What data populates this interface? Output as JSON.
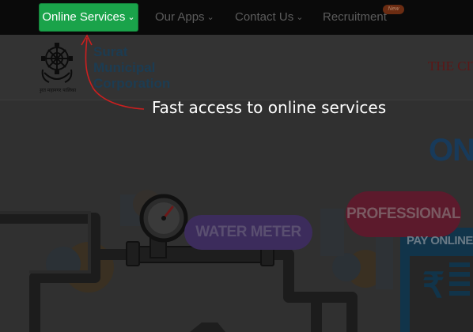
{
  "nav": {
    "online_services": "Online Services",
    "our_apps": "Our Apps",
    "contact_us": "Contact Us",
    "recruitment": "Recruitment",
    "new_badge": "New"
  },
  "header": {
    "logo_line1": "Surat",
    "logo_line2": "Municipal",
    "logo_line3": "Corporation",
    "logo_caption": "सुरत महानगर पालिका",
    "city_text": "THE CITY"
  },
  "hero": {
    "title": "ONL",
    "water_meter": "WATER METER",
    "professional": "PROFESSIONAL",
    "pay_online": "PAY ONLINE T",
    "rupee_symbol": "₹"
  },
  "tour": {
    "tooltip": "Fast access to online services"
  },
  "colors": {
    "active_nav": "#1aa34a",
    "overlay_bg": "#303030",
    "pointer": "#cc1f1f"
  },
  "icons": {
    "nav_chevron": "chevron-down-icon",
    "emblem": "smc-emblem-icon"
  }
}
